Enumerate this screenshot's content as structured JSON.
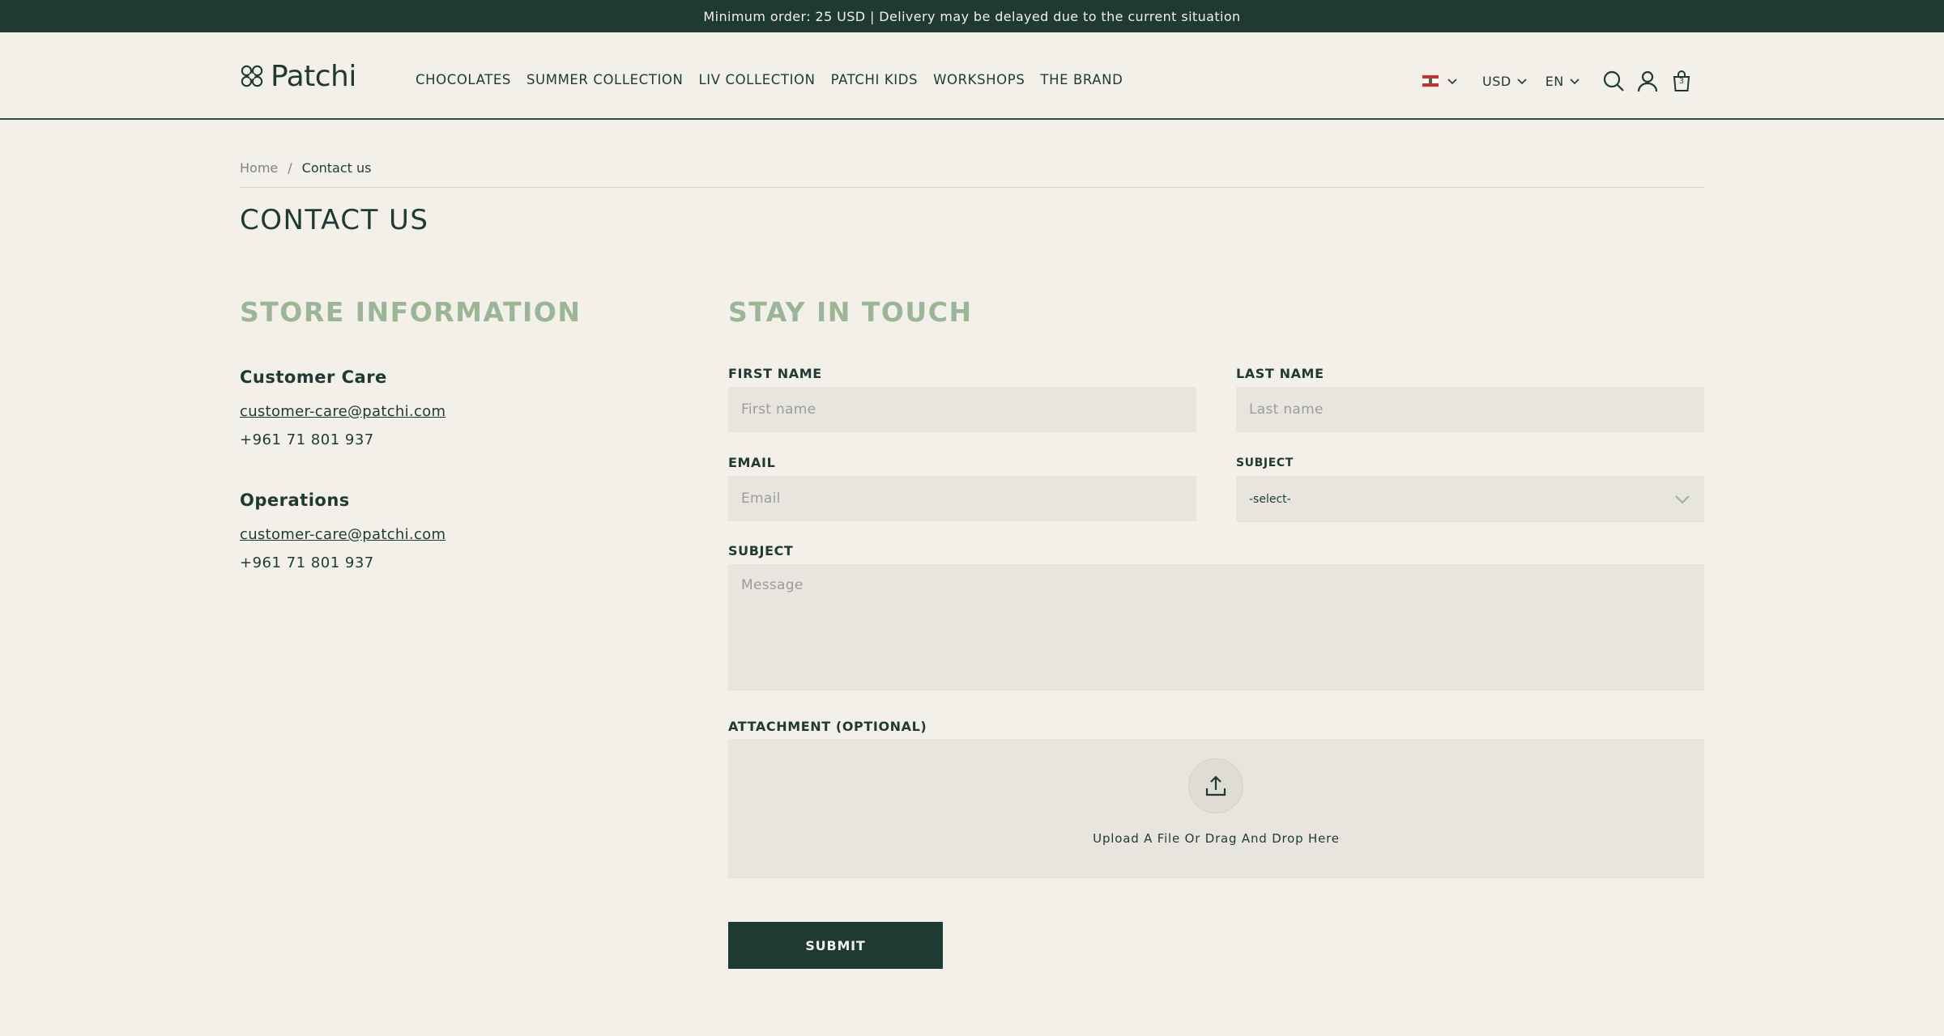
{
  "announcement": "Minimum order: 25 USD | Delivery may be delayed due to the current situation",
  "brand": {
    "name": "Patchi"
  },
  "nav": {
    "items": [
      "CHOCOLATES",
      "SUMMER COLLECTION",
      "LIV COLLECTION",
      "PATCHI KIDS",
      "WORKSHOPS",
      "THE BRAND"
    ]
  },
  "header_tools": {
    "country_flag": "lebanon-flag-icon",
    "currency": "USD",
    "language": "EN",
    "cart_count": "3"
  },
  "breadcrumb": {
    "home": "Home",
    "separator": "/",
    "current": "Contact us"
  },
  "page_title": "CONTACT US",
  "store_info": {
    "heading": "STORE INFORMATION",
    "contacts": [
      {
        "title": "Customer Care",
        "email": "customer-care@patchi.com",
        "phone": "+961 71 801 937"
      },
      {
        "title": "Operations",
        "email": "customer-care@patchi.com",
        "phone": "+961 71 801 937"
      }
    ]
  },
  "form": {
    "heading": "STAY IN TOUCH",
    "first_name": {
      "label": "FIRST NAME",
      "placeholder": "First name",
      "value": ""
    },
    "last_name": {
      "label": "LAST NAME",
      "placeholder": "Last name",
      "value": ""
    },
    "email": {
      "label": "EMAIL",
      "placeholder": "Email",
      "value": ""
    },
    "subject_select": {
      "label": "SUBJECT",
      "selected": "-select-"
    },
    "message": {
      "label": "SUBJECT",
      "placeholder": "Message",
      "value": ""
    },
    "attachment": {
      "label": "ATTACHMENT (OPTIONAL)",
      "upload_text": "Upload A File Or Drag And Drop Here"
    },
    "submit_label": "SUBMIT"
  },
  "colors": {
    "primary": "#1f3a33",
    "background": "#f3efe9",
    "field_background": "#e8e5df",
    "accent_heading": "#9cb597"
  }
}
